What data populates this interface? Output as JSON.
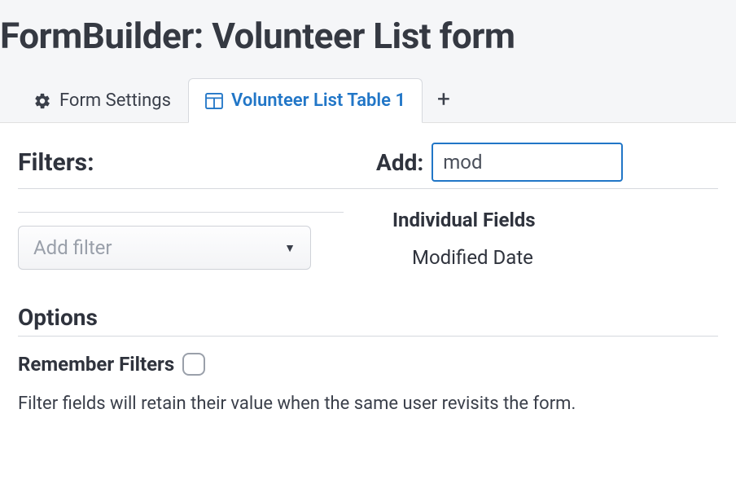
{
  "header": {
    "title": "FormBuilder: Volunteer List form"
  },
  "tabs": {
    "settings_label": "Form Settings",
    "active_label": "Volunteer List Table 1"
  },
  "filters": {
    "heading": "Filters:",
    "add_label": "Add:",
    "add_input_value": "mod",
    "add_filter_placeholder": "Add filter",
    "dropdown_group": "Individual Fields",
    "dropdown_item": "Modified Date"
  },
  "options": {
    "heading": "Options",
    "remember_label": "Remember Filters",
    "help_text": "Filter fields will retain their value when the same user revisits the form."
  }
}
